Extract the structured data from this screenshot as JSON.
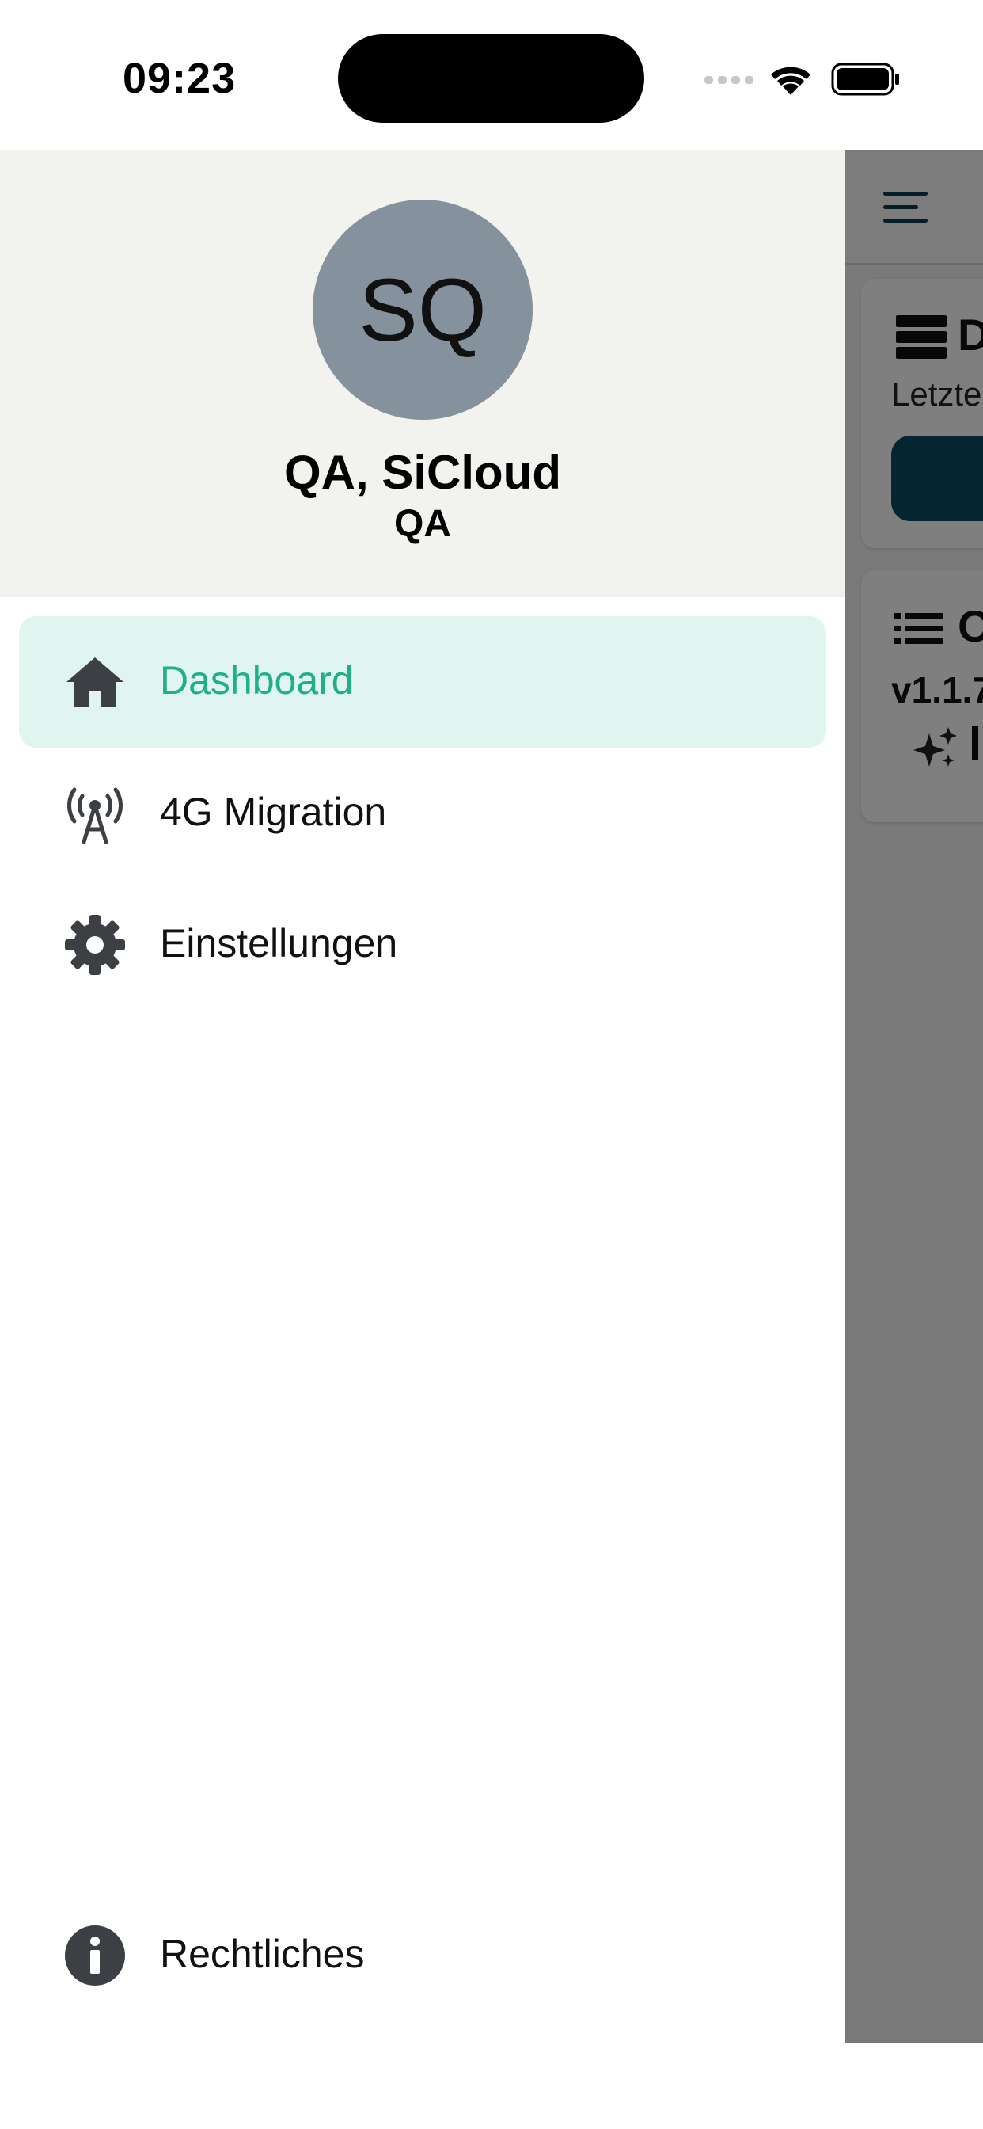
{
  "status_bar": {
    "time": "09:23",
    "icons": [
      "cellular-signal-icon",
      "wifi-icon",
      "battery-icon"
    ]
  },
  "drawer": {
    "avatar_initials": "SQ",
    "user_name": "QA, SiCloud",
    "organization": "QA",
    "items": [
      {
        "label": "Dashboard",
        "icon": "home-icon",
        "active": true
      },
      {
        "label": "4G Migration",
        "icon": "antenna-icon",
        "active": false
      },
      {
        "label": "Einstellungen",
        "icon": "gear-icon",
        "active": false
      }
    ],
    "footer_item": {
      "label": "Rechtliches",
      "icon": "info-icon"
    }
  },
  "background": {
    "card1_title": "D",
    "card1_subtitle": "Letzte",
    "card2_title": "C",
    "card2_version": "v1.1.7"
  },
  "colors": {
    "accent_green": "#1fb184",
    "active_item_bg": "#e0f5ef",
    "header_bg": "#f2f2ef",
    "avatar_bg": "#86919e",
    "primary_dark": "#0a4d63",
    "icon_color": "#3c4045"
  }
}
